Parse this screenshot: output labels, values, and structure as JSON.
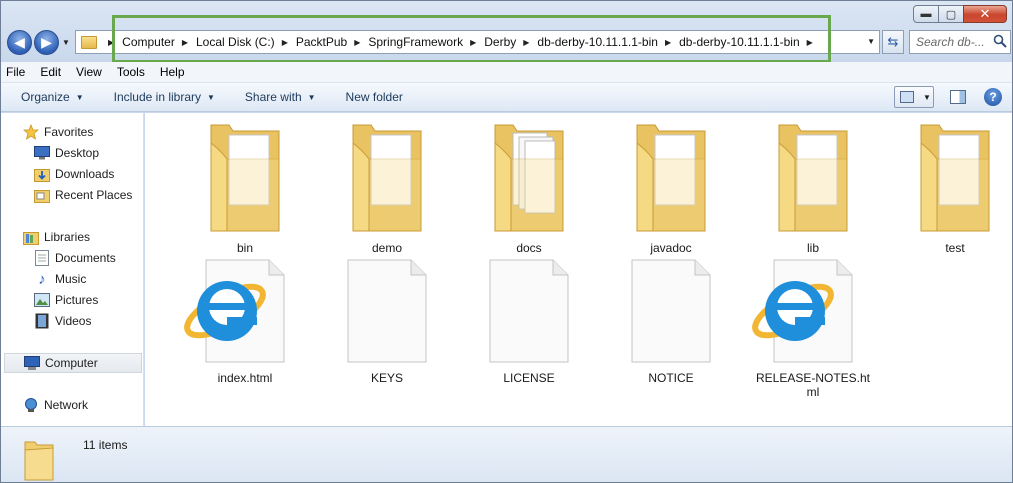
{
  "window": {
    "controls": {
      "minimize": "▬",
      "maximize": "▢",
      "close": "✕"
    }
  },
  "address": {
    "crumbs": [
      "Computer",
      "Local Disk (C:)",
      "PacktPub",
      "SpringFramework",
      "Derby",
      "db-derby-10.11.1.1-bin",
      "db-derby-10.11.1.1-bin"
    ]
  },
  "search": {
    "placeholder": "Search db-..."
  },
  "menu": [
    "File",
    "Edit",
    "View",
    "Tools",
    "Help"
  ],
  "toolbar": {
    "organize": "Organize",
    "include_in_library": "Include in library",
    "share_with": "Share with",
    "new_folder": "New folder"
  },
  "navpane": {
    "favorites": "Favorites",
    "desktop": "Desktop",
    "downloads": "Downloads",
    "recent_places": "Recent Places",
    "libraries": "Libraries",
    "documents": "Documents",
    "music": "Music",
    "pictures": "Pictures",
    "videos": "Videos",
    "computer": "Computer",
    "network": "Network"
  },
  "files": [
    {
      "name": "bin",
      "type": "folder-icon"
    },
    {
      "name": "demo",
      "type": "folder-icon"
    },
    {
      "name": "docs",
      "type": "folder-icon"
    },
    {
      "name": "javadoc",
      "type": "folder-icon"
    },
    {
      "name": "lib",
      "type": "folder-icon"
    },
    {
      "name": "test",
      "type": "folder-icon"
    },
    {
      "name": "index.html",
      "type": "ie-html-icon"
    },
    {
      "name": "KEYS",
      "type": "blank-file-icon"
    },
    {
      "name": "LICENSE",
      "type": "blank-file-icon"
    },
    {
      "name": "NOTICE",
      "type": "blank-file-icon"
    },
    {
      "name": "RELEASE-NOTES.html",
      "type": "ie-html-icon"
    }
  ],
  "status": {
    "item_count": "11 items"
  },
  "colors": {
    "highlight": "#6aa84f",
    "folder": "#f3d27a",
    "ie_blue": "#1f8fdc",
    "ie_ring": "#f2b632"
  }
}
